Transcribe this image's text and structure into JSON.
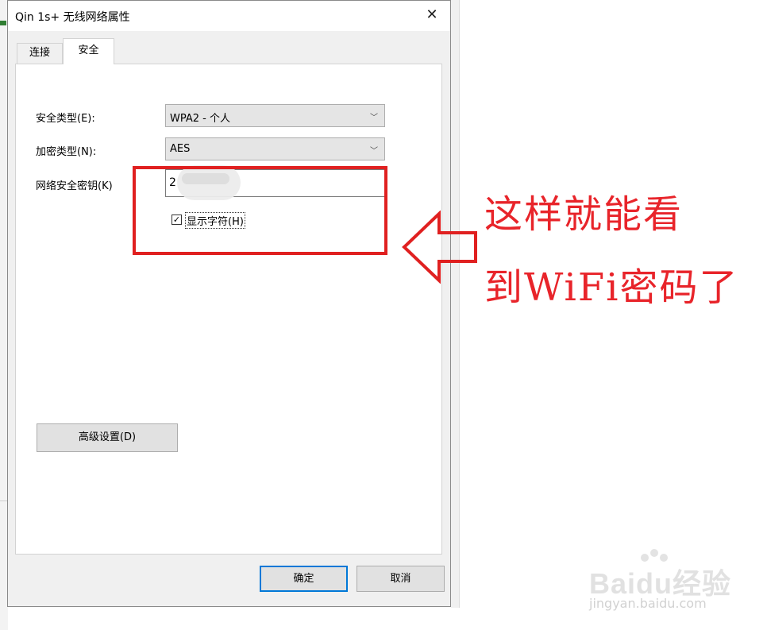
{
  "dialog": {
    "title": "Qin 1s+ 无线网络属性",
    "close_glyph": "✕",
    "tabs": [
      {
        "label": "连接",
        "selected": false
      },
      {
        "label": "安全",
        "selected": true
      }
    ],
    "security_type": {
      "label": "安全类型(E):",
      "value": "WPA2 - 个人"
    },
    "encryption_type": {
      "label": "加密类型(N):",
      "value": "AES"
    },
    "network_key": {
      "label": "网络安全密钥(K)",
      "value": "2"
    },
    "show_chars": {
      "label": "显示字符(H)",
      "checked": true,
      "check_glyph": "✓"
    },
    "advanced_button": "高级设置(D)",
    "ok_button": "确定",
    "cancel_button": "取消"
  },
  "annotation": {
    "line1": "这样就能看",
    "line2": "到WiFi密码了",
    "color": "#e8242a"
  },
  "watermark": {
    "logo": "Baidu经验",
    "url": "jingyan.baidu.com"
  },
  "colors": {
    "accent": "#0078d7",
    "highlight_red": "#e02020"
  }
}
